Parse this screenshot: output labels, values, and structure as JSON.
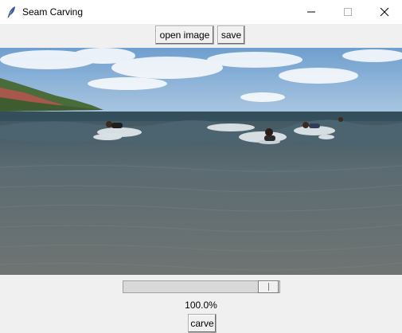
{
  "window": {
    "title": "Seam Carving",
    "icon": "feather-icon",
    "controls": [
      "minimize-icon",
      "maximize-icon",
      "close-icon"
    ]
  },
  "toolbar": {
    "open_label": "open image",
    "save_label": "save"
  },
  "image": {
    "description_icon": "photo-canvas",
    "colors": {
      "sky": "#8fb3d6",
      "water": "#55616a",
      "foam": "#e6ecef"
    }
  },
  "scale": {
    "value_fraction": 1.0,
    "label": "100.0%"
  },
  "actions": {
    "carve_label": "carve"
  }
}
